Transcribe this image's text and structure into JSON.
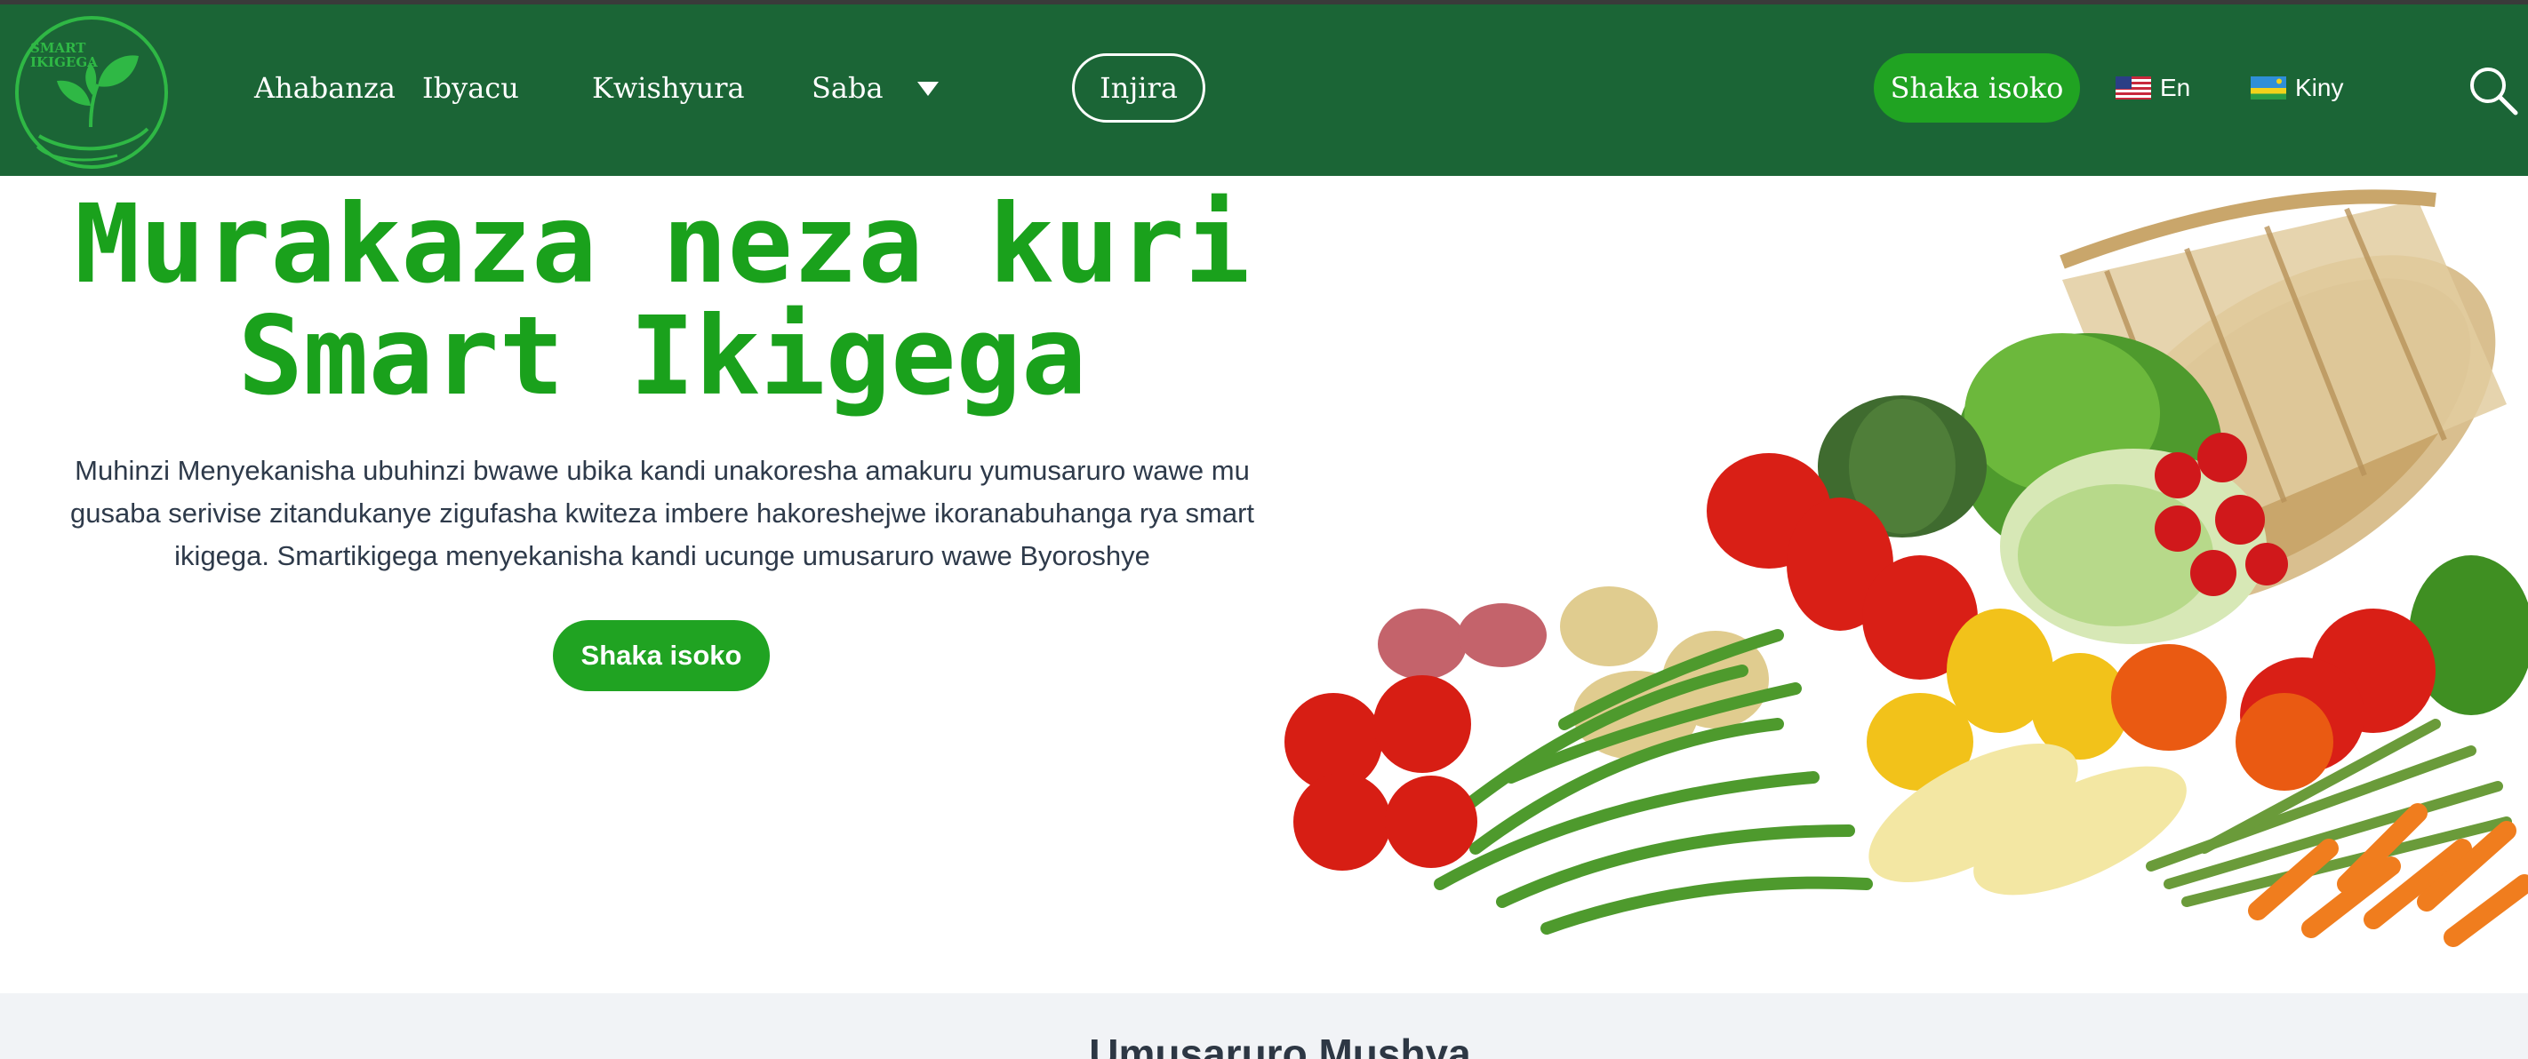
{
  "brand": {
    "logo_text": "SMART IKIGEGA"
  },
  "nav": {
    "links": [
      {
        "label": "Ahabanza"
      },
      {
        "label": "Ibyacu"
      },
      {
        "label": "Kwishyura"
      },
      {
        "label": "Saba"
      }
    ],
    "login_label": "Injira",
    "cta_label": "Shaka isoko",
    "languages": [
      {
        "label": "En",
        "flag_icon": "us-flag-icon"
      },
      {
        "label": "Kiny",
        "flag_icon": "rwanda-flag-icon"
      }
    ],
    "dropdown_icon": "caret-down-icon",
    "search_icon": "search-icon"
  },
  "hero": {
    "title_line1": "Murakaza neza kuri",
    "title_line2": "Smart Ikigega",
    "description": "Muhinzi Menyekanisha ubuhinzi bwawe ubika kandi unakoresha amakuru yumusaruro wawe mu gusaba serivise zitandukanye zigufasha kwiteza imbere hakoreshejwe ikoranabuhanga rya smart ikigega. Smartikigega menyekanisha kandi ucunge umusaruro wawe Byoroshye",
    "cta_label": "Shaka isoko"
  },
  "section": {
    "title": "Umusaruro Mushya"
  },
  "colors": {
    "navbar": "#1b6536",
    "accent_green": "#20a322",
    "title_green": "#1aa11c",
    "section_bg": "#f1f3f6"
  }
}
